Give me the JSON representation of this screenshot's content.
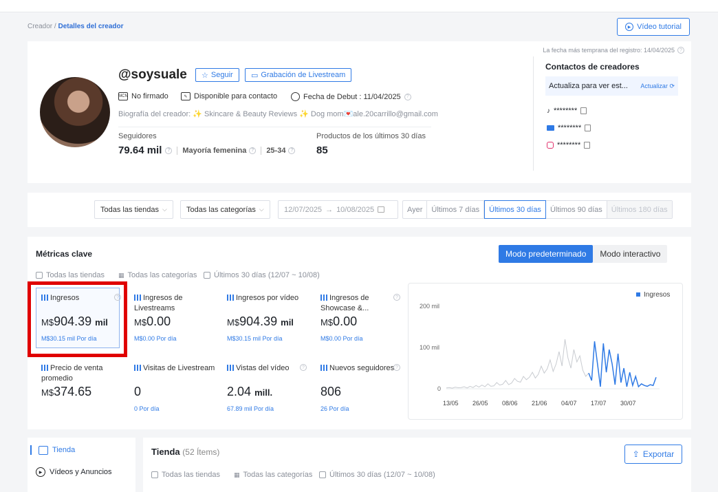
{
  "breadcrumb": {
    "parent": "Creador",
    "separator": " / ",
    "current": "Detalles del creador"
  },
  "video_tutorial": "Vídeo tutorial",
  "profile": {
    "handle": "@soysuale",
    "follow_label": "Seguir",
    "livestream_label": "Grabación de Livestream",
    "mcn_status": "No firmado",
    "contact_status": "Disponible para contacto",
    "debut": "Fecha de Debut : 11/04/2025",
    "bio": "Biografía del creador: ✨ Skincare & Beauty Reviews ✨ Dog mom💌ale.20carrillo@gmail.com",
    "followers_label": "Seguidores",
    "followers_value": "79.64 mil",
    "audience_gender": "Mayoría femenina",
    "audience_age": "25-34",
    "products_label": "Productos de los últimos 30 días",
    "products_value": "85",
    "registration_date": "La fecha más temprana del registro: 14/04/2025"
  },
  "contacts": {
    "title": "Contactos de creadores",
    "update_text": "Actualiza para ver est...",
    "update_link": "Actualizar",
    "items": [
      {
        "icon": "tiktok-icon",
        "value": "********"
      },
      {
        "icon": "email-icon",
        "value": "********"
      },
      {
        "icon": "instagram-icon",
        "value": "********"
      }
    ]
  },
  "filters": {
    "store": "Todas las tiendas",
    "category": "Todas las categorías",
    "date_start": "12/07/2025",
    "date_end": "10/08/2025",
    "ranges": [
      "Ayer",
      "Últimos 7 días",
      "Últimos 30 días",
      "Últimos 90 días",
      "Últimos 180 días"
    ],
    "active_range": "Últimos 30 días"
  },
  "metrics": {
    "title": "Métricas clave",
    "mode_default": "Modo predeterminado",
    "mode_interactive": "Modo interactivo",
    "scope_store": "Todas las tiendas",
    "scope_category": "Todas las categorías",
    "scope_period": "Últimos 30 días (12/07 ~ 10/08)",
    "cards": [
      {
        "label": "Ingresos",
        "cur": "M$",
        "value": "904.39",
        "unit": "mil",
        "per": "M$30.15 mil Por día"
      },
      {
        "label": "Ingresos de Livestreams",
        "cur": "M$",
        "value": "0.00",
        "unit": "",
        "per": "M$0.00 Por día"
      },
      {
        "label": "Ingresos por vídeo",
        "cur": "M$",
        "value": "904.39",
        "unit": "mil",
        "per": "M$30.15 mil Por día"
      },
      {
        "label": "Ingresos de Showcase &...",
        "cur": "M$",
        "value": "0.00",
        "unit": "",
        "per": "M$0.00 Por día"
      },
      {
        "label": "Precio de venta promedio",
        "cur": "M$",
        "value": "374.65",
        "unit": "",
        "per": ""
      },
      {
        "label": "Visitas de Livestream",
        "cur": "",
        "value": "0",
        "unit": "",
        "per": "0 Por día"
      },
      {
        "label": "Vistas del vídeo",
        "cur": "",
        "value": "2.04",
        "unit": "mill.",
        "per": "67.89 mil Por día"
      },
      {
        "label": "Nuevos seguidores",
        "cur": "",
        "value": "806",
        "unit": "",
        "per": "26 Por día"
      }
    ]
  },
  "chart_data": {
    "type": "line",
    "legend": "Ingresos",
    "y_ticks": [
      "0",
      "100 mil",
      "200 mil"
    ],
    "ylim": [
      0,
      200000
    ],
    "x_ticks": [
      "13/05",
      "26/05",
      "08/06",
      "21/06",
      "04/07",
      "17/07",
      "30/07"
    ],
    "series_gray": [
      2000,
      3000,
      1500,
      4000,
      2500,
      3000,
      5000,
      2000,
      6000,
      3000,
      8000,
      4000,
      9000,
      5000,
      12000,
      6000,
      7000,
      15000,
      9000,
      11000,
      20000,
      10000,
      14000,
      25000,
      18000,
      16000,
      30000,
      22000,
      28000,
      40000,
      26000,
      35000,
      55000,
      38000,
      48000,
      70000,
      42000,
      60000,
      90000,
      55000,
      120000,
      75000,
      50000,
      95000,
      65000,
      80000,
      45000,
      30000,
      38000
    ],
    "series_blue": [
      38000,
      20000,
      115000,
      60000,
      5000,
      110000,
      40000,
      95000,
      60000,
      10000,
      85000,
      15000,
      50000,
      5000,
      40000,
      8000,
      30000,
      5000,
      12000,
      8000,
      6000,
      10000,
      8000,
      28000
    ],
    "colors": {
      "primary": "#2f7ae5",
      "gray": "#c8cbd0"
    }
  },
  "shop": {
    "sidebar": [
      "Tienda",
      "Vídeos y Anuncios"
    ],
    "title": "Tienda",
    "count": "(52 Ítems)",
    "export": "Exportar",
    "scope_store": "Todas las tiendas",
    "scope_category": "Todas las categorías",
    "scope_period": "Últimos 30 días (12/07 ~ 10/08)"
  }
}
